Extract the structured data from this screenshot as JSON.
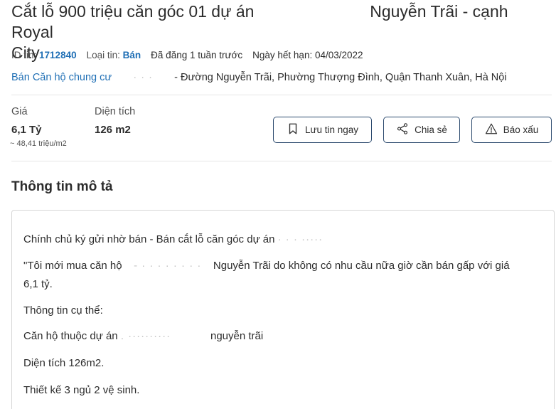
{
  "listing": {
    "title_line1": "Cắt lỗ 900 triệu căn góc 01 dự án",
    "title_blur": "     ",
    "title_line1_end": "Nguyễn Trãi - cạnh Royal",
    "title_line2": "City",
    "id_label": "ID tin:",
    "id_value": "1712840",
    "type_label": "Loại tin:",
    "type_value": "Bán",
    "posted": "Đã đăng 1 tuần trước",
    "expiry": "Ngày hết hạn: 04/03/2022",
    "address_category": "Bán Căn hộ chung cư",
    "address_blur": "· · ·",
    "address_text": "- Đường Nguyễn Trãi, Phường Thượng Đình, Quận Thanh Xuân, Hà Nội"
  },
  "stats": {
    "price_label": "Giá",
    "price_value": "6,1 Tỷ",
    "price_per_m2": "~ 48,41 triệu/m2",
    "area_label": "Diện tích",
    "area_value": "126 m2"
  },
  "actions": {
    "save_label": "Lưu tin ngay",
    "share_label": "Chia sẻ",
    "report_label": "Báo xấu"
  },
  "description": {
    "heading": "Thông tin mô tả",
    "line1": "Chính chủ ký gửi nhờ bán - Bán cắt lỗ căn góc dự án",
    "line1_blur": "· · · ·····",
    "line2_start": "\"Tôi mới mua căn hộ",
    "line2_blur": "- · · · ·  · · · ·",
    "line2_end": "Nguyễn Trãi do không có nhu cầu nữa giờ cần bán gấp với giá",
    "line3": "6,1 tỷ.",
    "line4": "Thông tin cụ thể:",
    "line5_start": "Căn hộ thuộc dự án",
    "line5_blur": ".    ··········",
    "line5_end": "nguyễn trãi",
    "line6": "Diện tích 126m2.",
    "line7": "Thiết kế 3 ngủ 2 vệ sinh."
  },
  "colors": {
    "accent_blue": "#1f6fb5",
    "button_border": "#2c4a6e"
  }
}
